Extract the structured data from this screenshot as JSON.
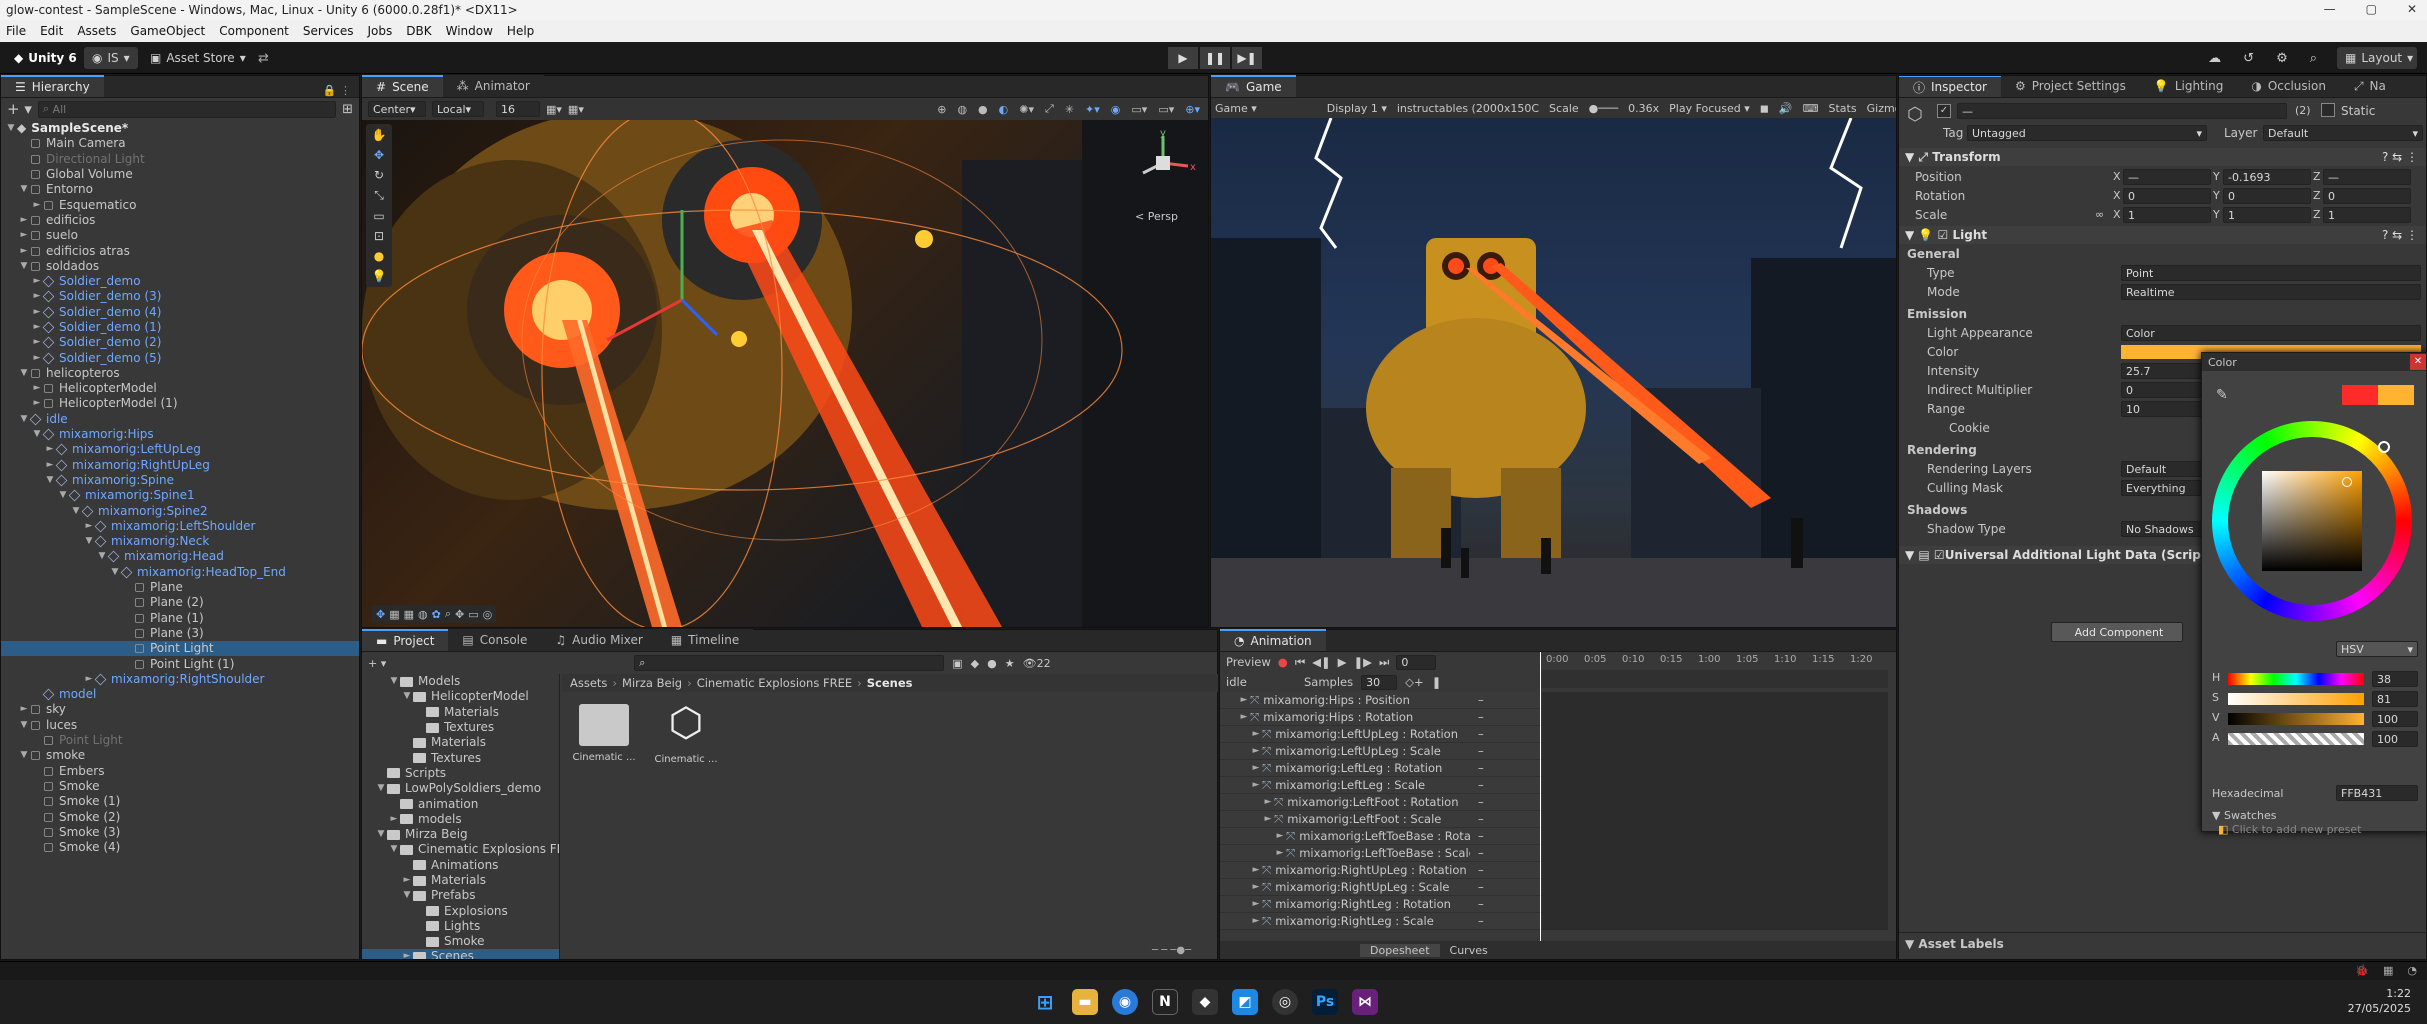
{
  "window": {
    "title": "glow-contest - SampleScene - Windows, Mac, Linux - Unity 6 (6000.0.28f1)* <DX11>"
  },
  "menu": [
    "File",
    "Edit",
    "Assets",
    "GameObject",
    "Component",
    "Services",
    "Jobs",
    "DBK",
    "Window",
    "Help"
  ],
  "toolbar": {
    "account": "Unity 6",
    "user": "IS",
    "asset_store": "Asset Store",
    "layout": "Layout"
  },
  "hierarchy": {
    "tab": "Hierarchy",
    "search_placeholder": "All",
    "rows": [
      {
        "t": "SampleScene*",
        "d": 0,
        "k": "scene",
        "s": "hdr",
        "a": "▼"
      },
      {
        "t": "Main Camera",
        "d": 1,
        "k": "go"
      },
      {
        "t": "Directional Light",
        "d": 1,
        "k": "go",
        "s": "dim"
      },
      {
        "t": "Global Volume",
        "d": 1,
        "k": "go"
      },
      {
        "t": "Entorno",
        "d": 1,
        "k": "go",
        "a": "▼"
      },
      {
        "t": "Esquematico",
        "d": 2,
        "k": "go",
        "a": "►"
      },
      {
        "t": "edificios",
        "d": 1,
        "k": "go",
        "a": "►"
      },
      {
        "t": "suelo",
        "d": 1,
        "k": "go",
        "a": "►"
      },
      {
        "t": "edificios atras",
        "d": 1,
        "k": "go",
        "a": "►"
      },
      {
        "t": "soldados",
        "d": 1,
        "k": "go",
        "a": "▼"
      },
      {
        "t": "Soldier_demo",
        "d": 2,
        "k": "prefab",
        "s": "blue",
        "a": "►"
      },
      {
        "t": "Soldier_demo (3)",
        "d": 2,
        "k": "prefab",
        "s": "blue",
        "a": "►"
      },
      {
        "t": "Soldier_demo (4)",
        "d": 2,
        "k": "prefab",
        "s": "blue",
        "a": "►"
      },
      {
        "t": "Soldier_demo (1)",
        "d": 2,
        "k": "prefab",
        "s": "blue",
        "a": "►"
      },
      {
        "t": "Soldier_demo (2)",
        "d": 2,
        "k": "prefab",
        "s": "blue",
        "a": "►"
      },
      {
        "t": "Soldier_demo (5)",
        "d": 2,
        "k": "prefab",
        "s": "blue",
        "a": "►"
      },
      {
        "t": "helicopteros",
        "d": 1,
        "k": "go",
        "a": "▼"
      },
      {
        "t": "HelicopterModel",
        "d": 2,
        "k": "go",
        "a": "►"
      },
      {
        "t": "HelicopterModel (1)",
        "d": 2,
        "k": "go",
        "a": "►"
      },
      {
        "t": "idle",
        "d": 1,
        "k": "prefab",
        "s": "blue",
        "a": "▼"
      },
      {
        "t": "mixamorig:Hips",
        "d": 2,
        "k": "prefab",
        "s": "blue",
        "a": "▼"
      },
      {
        "t": "mixamorig:LeftUpLeg",
        "d": 3,
        "k": "prefab",
        "s": "blue",
        "a": "►"
      },
      {
        "t": "mixamorig:RightUpLeg",
        "d": 3,
        "k": "prefab",
        "s": "blue",
        "a": "►"
      },
      {
        "t": "mixamorig:Spine",
        "d": 3,
        "k": "prefab",
        "s": "blue",
        "a": "▼"
      },
      {
        "t": "mixamorig:Spine1",
        "d": 4,
        "k": "prefab",
        "s": "blue",
        "a": "▼"
      },
      {
        "t": "mixamorig:Spine2",
        "d": 5,
        "k": "prefab",
        "s": "blue",
        "a": "▼"
      },
      {
        "t": "mixamorig:LeftShoulder",
        "d": 6,
        "k": "prefab",
        "s": "blue",
        "a": "►"
      },
      {
        "t": "mixamorig:Neck",
        "d": 6,
        "k": "prefab",
        "s": "blue",
        "a": "▼"
      },
      {
        "t": "mixamorig:Head",
        "d": 7,
        "k": "prefab",
        "s": "blue",
        "a": "▼"
      },
      {
        "t": "mixamorig:HeadTop_End",
        "d": 8,
        "k": "prefab",
        "s": "blue",
        "a": "▼"
      },
      {
        "t": "Plane",
        "d": 9,
        "k": "go"
      },
      {
        "t": "Plane (2)",
        "d": 9,
        "k": "go"
      },
      {
        "t": "Plane (1)",
        "d": 9,
        "k": "go"
      },
      {
        "t": "Plane (3)",
        "d": 9,
        "k": "go"
      },
      {
        "t": "Point Light",
        "d": 9,
        "k": "go",
        "s": "sel"
      },
      {
        "t": "Point Light (1)",
        "d": 9,
        "k": "go"
      },
      {
        "t": "mixamorig:RightShoulder",
        "d": 6,
        "k": "prefab",
        "s": "blue",
        "a": "►"
      },
      {
        "t": "model",
        "d": 2,
        "k": "prefab",
        "s": "blue"
      },
      {
        "t": "sky",
        "d": 1,
        "k": "go",
        "a": "►"
      },
      {
        "t": "luces",
        "d": 1,
        "k": "go",
        "a": "▼"
      },
      {
        "t": "Point Light",
        "d": 2,
        "k": "go",
        "s": "dim"
      },
      {
        "t": "smoke",
        "d": 1,
        "k": "go",
        "a": "▼"
      },
      {
        "t": "Embers",
        "d": 2,
        "k": "go"
      },
      {
        "t": "Smoke",
        "d": 2,
        "k": "go"
      },
      {
        "t": "Smoke (1)",
        "d": 2,
        "k": "go"
      },
      {
        "t": "Smoke (2)",
        "d": 2,
        "k": "go"
      },
      {
        "t": "Smoke (3)",
        "d": 2,
        "k": "go"
      },
      {
        "t": "Smoke (4)",
        "d": 2,
        "k": "go"
      }
    ]
  },
  "scene": {
    "tab": "Scene",
    "tab2": "Animator",
    "pivot": "Center",
    "space": "Local",
    "snap": "16",
    "persp": "< Persp"
  },
  "game": {
    "tab": "Game",
    "mode": "Game",
    "display": "Display 1",
    "resolution": "instructables (2000x150C",
    "scale_label": "Scale",
    "scale": "0.36x",
    "play": "Play Focused",
    "stats": "Stats",
    "gizmos": "Gizmo"
  },
  "project": {
    "tab": "Project",
    "tab2": "Console",
    "tab3": "Audio Mixer",
    "tab4": "Timeline",
    "count": "22",
    "breadcrumb": [
      "Assets",
      "Mirza Beig",
      "Cinematic Explosions FREE",
      "Scenes"
    ],
    "tree": [
      {
        "t": "Models",
        "d": 2,
        "a": "▼"
      },
      {
        "t": "HelicopterModel",
        "d": 3,
        "a": "▼"
      },
      {
        "t": "Materials",
        "d": 4
      },
      {
        "t": "Textures",
        "d": 4
      },
      {
        "t": "Materials",
        "d": 3
      },
      {
        "t": "Textures",
        "d": 3
      },
      {
        "t": "Scripts",
        "d": 1
      },
      {
        "t": "LowPolySoldiers_demo",
        "d": 1,
        "a": "▼"
      },
      {
        "t": "animation",
        "d": 2
      },
      {
        "t": "models",
        "d": 2,
        "a": "►"
      },
      {
        "t": "Mirza Beig",
        "d": 1,
        "a": "▼"
      },
      {
        "t": "Cinematic Explosions FI",
        "d": 2,
        "a": "▼"
      },
      {
        "t": "Animations",
        "d": 3
      },
      {
        "t": "Materials",
        "d": 3,
        "a": "►"
      },
      {
        "t": "Prefabs",
        "d": 3,
        "a": "▼"
      },
      {
        "t": "Explosions",
        "d": 4
      },
      {
        "t": "Lights",
        "d": 4
      },
      {
        "t": "Smoke",
        "d": 4
      },
      {
        "t": "Scenes",
        "d": 3,
        "s": "sel",
        "a": "►"
      }
    ],
    "items": [
      {
        "name": "Cinematic ...",
        "kind": "folder"
      },
      {
        "name": "Cinematic ...",
        "kind": "unity"
      }
    ]
  },
  "animation": {
    "tab": "Animation",
    "preview": "Preview",
    "frame": "0",
    "clip": "idle",
    "samples_label": "Samples",
    "samples": "30",
    "ruler": [
      "0:00",
      "0:05",
      "0:10",
      "0:15",
      "1:00",
      "1:05",
      "1:10",
      "1:15",
      "1:20"
    ],
    "tracks": [
      {
        "t": "mixamorig:Hips : Position",
        "d": 0,
        "a": "►"
      },
      {
        "t": "mixamorig:Hips : Rotation",
        "d": 0,
        "a": "►"
      },
      {
        "t": "mixamorig:LeftUpLeg : Rotation",
        "d": 1,
        "a": "►"
      },
      {
        "t": "mixamorig:LeftUpLeg : Scale",
        "d": 1,
        "a": "►"
      },
      {
        "t": "mixamorig:LeftLeg : Rotation",
        "d": 1,
        "a": "►"
      },
      {
        "t": "mixamorig:LeftLeg : Scale",
        "d": 1,
        "a": "►"
      },
      {
        "t": "mixamorig:LeftFoot : Rotation",
        "d": 2,
        "a": "►"
      },
      {
        "t": "mixamorig:LeftFoot : Scale",
        "d": 2,
        "a": "►"
      },
      {
        "t": "mixamorig:LeftToeBase : Rotatio",
        "d": 3,
        "a": "►"
      },
      {
        "t": "mixamorig:LeftToeBase : Scale",
        "d": 3,
        "a": "►"
      },
      {
        "t": "mixamorig:RightUpLeg : Rotation",
        "d": 1,
        "a": "►"
      },
      {
        "t": "mixamorig:RightUpLeg : Scale",
        "d": 1,
        "a": "►"
      },
      {
        "t": "mixamorig:RightLeg : Rotation",
        "d": 1,
        "a": "►"
      },
      {
        "t": "mixamorig:RightLeg : Scale",
        "d": 1,
        "a": "►"
      }
    ],
    "dopesheet": "Dopesheet",
    "curves": "Curves"
  },
  "inspector": {
    "tab": "Inspector",
    "tab2": "Project Settings",
    "tab3": "Lighting",
    "tab4": "Occlusion",
    "tab5": "Na",
    "count": "(2)",
    "static": "Static",
    "tag_label": "Tag",
    "tag": "Untagged",
    "layer_label": "Layer",
    "layer": "Default",
    "transform": {
      "title": "Transform",
      "position_label": "Position",
      "rotation_label": "Rotation",
      "scale_label": "Scale",
      "position": [
        "—",
        "-0.1693",
        "—"
      ],
      "rotation": [
        "0",
        "0",
        "0"
      ],
      "scale": [
        "1",
        "1",
        "1"
      ]
    },
    "light": {
      "title": "Light",
      "general": "General",
      "type_label": "Type",
      "type": "Point",
      "mode_label": "Mode",
      "mode": "Realtime",
      "emission": "Emission",
      "appearance_label": "Light Appearance",
      "appearance": "Color",
      "color_label": "Color",
      "intensity_label": "Intensity",
      "intensity": "25.7",
      "indirect_label": "Indirect Multiplier",
      "indirect": "0",
      "range_label": "Range",
      "range": "10",
      "cookie_label": "Cookie",
      "rendering": "Rendering",
      "layers_label": "Rendering Layers",
      "layers": "Default",
      "culling_label": "Culling Mask",
      "culling": "Everything",
      "shadows": "Shadows",
      "shadow_type_label": "Shadow Type",
      "shadow_type": "No Shadows"
    },
    "urp": "Universal Additional Light Data (Script)",
    "add_component": "Add Component",
    "asset_labels": "Asset Labels"
  },
  "colorpicker": {
    "title": "Color",
    "model": "HSV",
    "h": "38",
    "s": "81",
    "v": "100",
    "a": "100",
    "hex_label": "Hexadecimal",
    "hex": "FFB431",
    "swatches": "Swatches",
    "add_preset": "Click to add new preset",
    "current_color": "#ffb431",
    "previous_color": "#ff2b2b"
  },
  "taskbar": {
    "time": "1:22",
    "date": "27/05/2025"
  },
  "colors": {
    "accent": "#4b9fff",
    "prefab": "#6fa8ff",
    "selection": "#2c5d87"
  }
}
